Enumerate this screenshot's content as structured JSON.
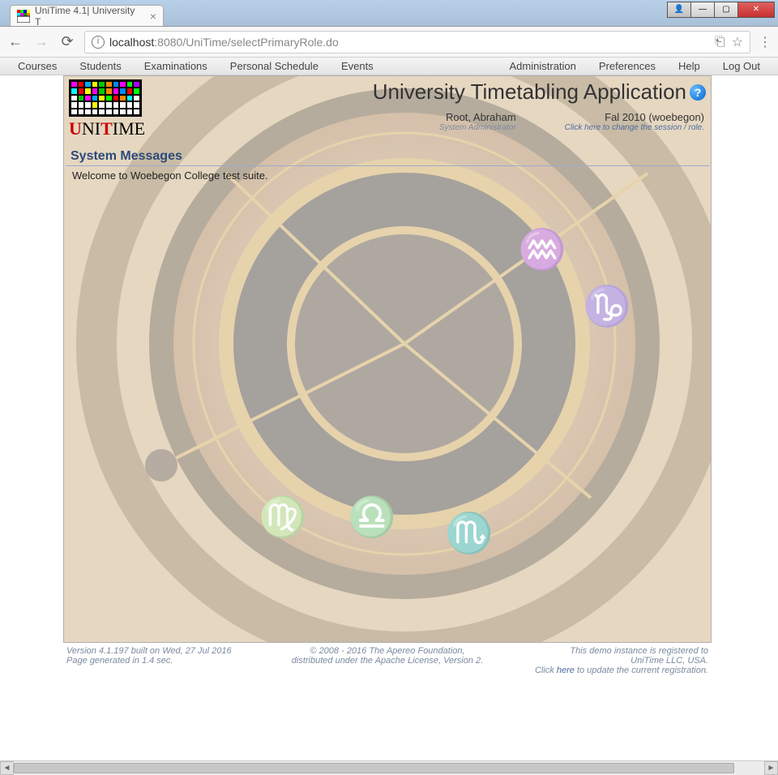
{
  "browser": {
    "tab_title": "UniTime 4.1| University T",
    "url_host": "localhost",
    "url_port": ":8080",
    "url_path": "/UniTime/selectPrimaryRole.do"
  },
  "menu": {
    "left": [
      "Courses",
      "Students",
      "Examinations",
      "Personal Schedule",
      "Events"
    ],
    "right": [
      "Administration",
      "Preferences",
      "Help",
      "Log Out"
    ]
  },
  "header": {
    "app_title": "University Timetabling Application",
    "logo_text_parts": {
      "u": "U",
      "ni": "NI",
      "t": "T",
      "ime": "IME"
    },
    "user_name": "Root, Abraham",
    "user_role": "System Administrator",
    "session_label": "Fal 2010 (woebegon)",
    "session_hint": "Click here to change the session / role."
  },
  "messages": {
    "title": "System Messages",
    "body": "Welcome to Woebegon College test suite."
  },
  "footer": {
    "version": "Version 4.1.197 built on Wed, 27 Jul 2016",
    "gen": "Page generated in 1.4 sec.",
    "copyright1": "© 2008 - 2016 The Apereo Foundation,",
    "copyright2": "distributed under the Apache License, Version 2.",
    "reg1": "This demo instance is registered to",
    "reg2": "UniTime LLC, USA.",
    "reg3_pre": "Click ",
    "reg3_link": "here",
    "reg3_post": " to update the current registration."
  }
}
